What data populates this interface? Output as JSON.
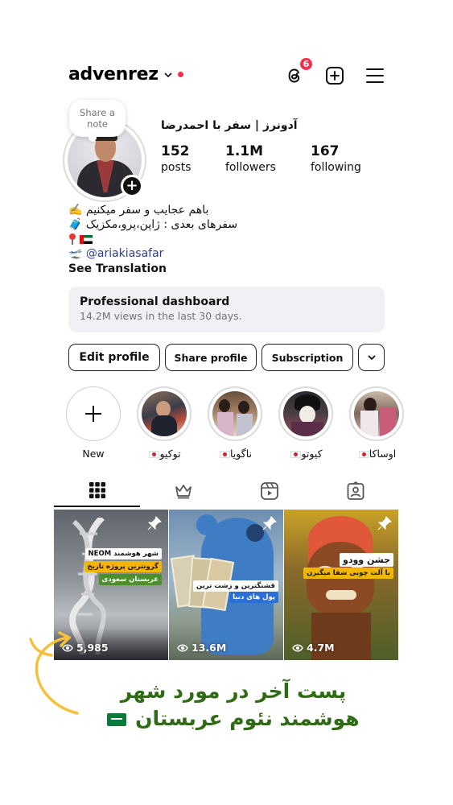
{
  "header": {
    "username": "advenrez",
    "notification_count": "6",
    "icons": [
      "threads-icon",
      "create-icon",
      "menu-icon"
    ]
  },
  "profile": {
    "note_placeholder": "Share a note",
    "display_name": "آدونرز | سفر با احمدرضا",
    "stats": [
      {
        "value": "152",
        "label": "posts"
      },
      {
        "value": "1.1M",
        "label": "followers"
      },
      {
        "value": "167",
        "label": "following"
      }
    ]
  },
  "bio": {
    "line1": "باهم عجایب و سفر میکنیم ✍️",
    "line2": "سفرهای بعدی : ژاپن،پرو،مکزیک 🧳",
    "link_prefix": "🛫",
    "link": "@ariakiasafar",
    "see_translation": "See Translation"
  },
  "dashboard": {
    "title": "Professional dashboard",
    "subtitle": "14.2M views in the last 30 days."
  },
  "actions": {
    "edit": "Edit profile",
    "share": "Share profile",
    "subscription": "Subscription"
  },
  "highlights": {
    "new_label": "New",
    "items": [
      {
        "label": "توکیو"
      },
      {
        "label": "ناگویا"
      },
      {
        "label": "کیوتو"
      },
      {
        "label": "اوساکا"
      }
    ]
  },
  "tabs": [
    "grid",
    "subscriptions",
    "reels",
    "tagged"
  ],
  "posts": [
    {
      "views": "5,985",
      "tag_top": "شهر هوشمند NEOM",
      "tag_mid": "گرونترین پروژه تاریخ",
      "tag_bot": "عربستان سعودی"
    },
    {
      "views": "13.6M",
      "tag_top": "قشنگترین و زشت ترین",
      "tag_bot": "پول های دنیا"
    },
    {
      "views": "4.7M",
      "tag_top": "جشن وودو",
      "tag_bot": "با آلت چوبی شفا میگیرن"
    }
  ],
  "caption": {
    "line1": "پست آخر در مورد شهر",
    "line2": "هوشمند نئوم عربستان"
  },
  "colors": {
    "accent_red": "#ff2b4a",
    "link_blue": "#2b3f91",
    "caption_green": "#2f6b15",
    "arrow_yellow": "#f5c13a"
  }
}
